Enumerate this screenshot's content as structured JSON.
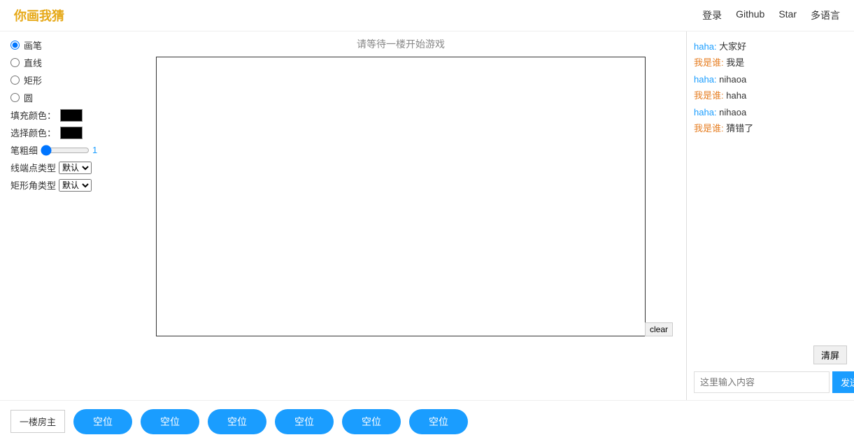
{
  "header": {
    "title": "你画我猜",
    "nav": [
      {
        "label": "登录",
        "name": "login-link"
      },
      {
        "label": "Github",
        "name": "github-link"
      },
      {
        "label": "Star",
        "name": "star-link"
      },
      {
        "label": "多语言",
        "name": "language-link"
      }
    ]
  },
  "canvas": {
    "status_text": "请等待一楼开始游戏",
    "clear_button": "clear"
  },
  "toolbar": {
    "tools": [
      {
        "label": "画笔",
        "value": "pen",
        "checked": true
      },
      {
        "label": "直线",
        "value": "line",
        "checked": false
      },
      {
        "label": "矩形",
        "value": "rect",
        "checked": false
      },
      {
        "label": "圆",
        "value": "circle",
        "checked": false
      }
    ],
    "fill_color_label": "填充颜色：",
    "stroke_color_label": "选择颜色：",
    "stroke_width_label": "笔粗细",
    "stroke_width_value": "1",
    "line_cap_label": "线端点类型",
    "line_cap_default": "默认",
    "rect_corner_label": "矩形角类型",
    "rect_corner_default": "默认"
  },
  "chat": {
    "messages": [
      {
        "user": "haha",
        "text": "大家好",
        "user_class": "user1"
      },
      {
        "user": "我是谁",
        "text": "我是",
        "user_class": "user2"
      },
      {
        "user": "haha",
        "text": "nihaoa",
        "user_class": "user1"
      },
      {
        "user": "我是谁",
        "text": "haha",
        "user_class": "user2"
      },
      {
        "user": "haha",
        "text": "nihaoa",
        "user_class": "user1"
      },
      {
        "user": "我是谁",
        "text": "猜错了",
        "user_class": "user2"
      }
    ],
    "clear_button": "清屏",
    "input_placeholder": "这里输入内容",
    "send_button": "发送"
  },
  "players": {
    "host_label": "一楼房主",
    "slots": [
      "空位",
      "空位",
      "空位",
      "空位",
      "空位",
      "空位"
    ]
  }
}
